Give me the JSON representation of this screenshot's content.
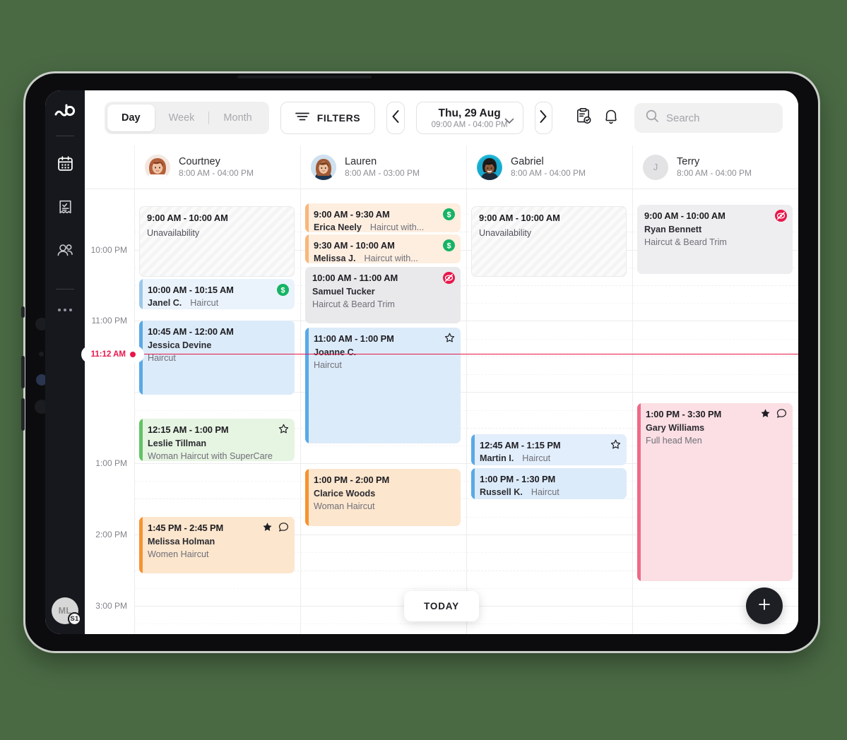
{
  "app": {
    "logo_icon": "bookings-logo-icon",
    "rail_items": [
      {
        "icon": "calendar-icon",
        "name": "calendar"
      },
      {
        "icon": "receipt-check-icon",
        "name": "sales"
      },
      {
        "icon": "clients-icon",
        "name": "clients"
      }
    ],
    "more_icon": "more-dots-icon",
    "user_avatar": {
      "initials": "ML",
      "badge": "S1"
    }
  },
  "toolbar": {
    "views": [
      {
        "label": "Day",
        "active": true
      },
      {
        "label": "Week",
        "active": false
      },
      {
        "label": "Month",
        "active": false
      }
    ],
    "filters_label": "FILTERS",
    "filters_icon": "filter-lines-icon",
    "prev_icon": "chevron-left-icon",
    "next_icon": "chevron-right-icon",
    "date_title": "Thu, 29 Aug",
    "date_range": "09:00 AM - 04:00 PM",
    "date_caret_icon": "chevron-down-icon",
    "clipboard_icon": "clipboard-check-icon",
    "bell_icon": "bell-icon",
    "search": {
      "icon": "search-icon",
      "placeholder": "Search",
      "value": ""
    }
  },
  "staff": [
    {
      "name": "Courtney",
      "hours": "8:00 AM - 04:00 PM",
      "has_photo": true,
      "photo_bg": "#efe3dc",
      "initial": "C"
    },
    {
      "name": "Lauren",
      "hours": "8:00 AM - 03:00 PM",
      "has_photo": true,
      "photo_bg": "#cfe0ef",
      "initial": "L"
    },
    {
      "name": "Gabriel",
      "hours": "8:00 AM - 04:00 PM",
      "has_photo": true,
      "photo_bg": "#1fb6d8",
      "initial": "G"
    },
    {
      "name": "Terry",
      "hours": "8:00 AM - 04:00 PM",
      "has_photo": false,
      "photo_bg": "#e3e3e5",
      "initial": "J"
    }
  ],
  "calendar": {
    "time_labels": [
      "10:00 PM",
      "11:00 PM",
      "1:00 PM",
      "2:00 PM",
      "3:00 PM"
    ],
    "now_marker": {
      "label": "11:12 AM",
      "color": "#e8174b"
    },
    "today_button": "TODAY",
    "add_button_icon": "plus-icon",
    "columns": [
      {
        "staff": "Courtney",
        "appointments": [
          {
            "time": "9:00 AM - 10:00 AM",
            "client": "",
            "service": "Unavailability",
            "type": "unavailable",
            "layout": "block",
            "badges": []
          },
          {
            "time": "10:00 AM - 10:15 AM",
            "client": "Janel C.",
            "service": "Haircut",
            "type": "blue",
            "layout": "compact",
            "badges": [
              "paid-icon"
            ]
          },
          {
            "time": "10:45 AM - 12:00 AM",
            "client": "Jessica Devine",
            "service": "Haircut",
            "type": "blue",
            "layout": "block",
            "badges": []
          },
          {
            "time": "12:15 AM - 1:00 PM",
            "client": "Leslie Tillman",
            "service": "Woman Haircut with SuperCare",
            "type": "green",
            "layout": "block",
            "badges": [
              "star-outline-icon"
            ]
          },
          {
            "time": "1:45 PM - 2:45 PM",
            "client": "Melissa Holman",
            "service": "Women Haircut",
            "type": "orange",
            "layout": "block",
            "badges": [
              "star-filled-icon",
              "comment-icon"
            ]
          }
        ]
      },
      {
        "staff": "Lauren",
        "appointments": [
          {
            "time": "9:00 AM - 9:30 AM",
            "client": "Erica Neely",
            "service": "Haircut with...",
            "type": "peach",
            "layout": "compact",
            "badges": [
              "paid-icon"
            ]
          },
          {
            "time": "9:30 AM - 10:00 AM",
            "client": "Melissa J.",
            "service": "Haircut with...",
            "type": "peach",
            "layout": "compact",
            "badges": [
              "paid-icon"
            ]
          },
          {
            "time": "10:00 AM - 11:00 AM",
            "client": "Samuel Tucker",
            "service": "Haircut & Beard Trim",
            "type": "grey",
            "layout": "block",
            "badges": [
              "no-show-icon"
            ]
          },
          {
            "time": "11:00 AM - 1:00 PM",
            "client": "Joanne C.",
            "service": "Haircut",
            "type": "blue",
            "layout": "block",
            "badges": [
              "star-outline-icon"
            ]
          },
          {
            "time": "1:00 PM - 2:00 PM",
            "client": "Clarice Woods",
            "service": "Woman Haircut",
            "type": "orange",
            "layout": "block",
            "badges": []
          }
        ]
      },
      {
        "staff": "Gabriel",
        "appointments": [
          {
            "time": "9:00 AM - 10:00 AM",
            "client": "",
            "service": "Unavailability",
            "type": "unavailable",
            "layout": "block",
            "badges": []
          },
          {
            "time": "12:45 AM - 1:15 PM",
            "client": "Martin I.",
            "service": "Haircut",
            "type": "blue",
            "layout": "compact",
            "badges": [
              "star-outline-icon"
            ]
          },
          {
            "time": "1:00 PM - 1:30 PM",
            "client": "Russell K.",
            "service": "Haircut",
            "type": "blue",
            "layout": "compact",
            "badges": []
          }
        ]
      },
      {
        "staff": "Terry",
        "appointments": [
          {
            "time": "9:00 AM - 10:00 AM",
            "client": "Ryan Bennett",
            "service": "Haircut & Beard Trim",
            "type": "grey",
            "layout": "block",
            "badges": [
              "no-show-icon"
            ]
          },
          {
            "time": "1:00 PM - 3:30 PM",
            "client": "Gary Williams",
            "service": "Full head Men",
            "type": "pink",
            "layout": "block",
            "badges": [
              "star-filled-icon",
              "comment-icon"
            ]
          }
        ]
      }
    ]
  },
  "colors": {
    "page_bg": "#4a6a44",
    "rail_bg": "#16181d",
    "accent_red": "#e8174b",
    "paid_green": "#16b364",
    "no_show_red": "#e8174b",
    "blue_bar": "#5aa9e6",
    "green_bar": "#62c462",
    "orange_bar": "#f59331",
    "peach_bar": "#f7b77a",
    "pink_bar": "#ef6a88",
    "grey_bar": "#e6e6e8"
  }
}
